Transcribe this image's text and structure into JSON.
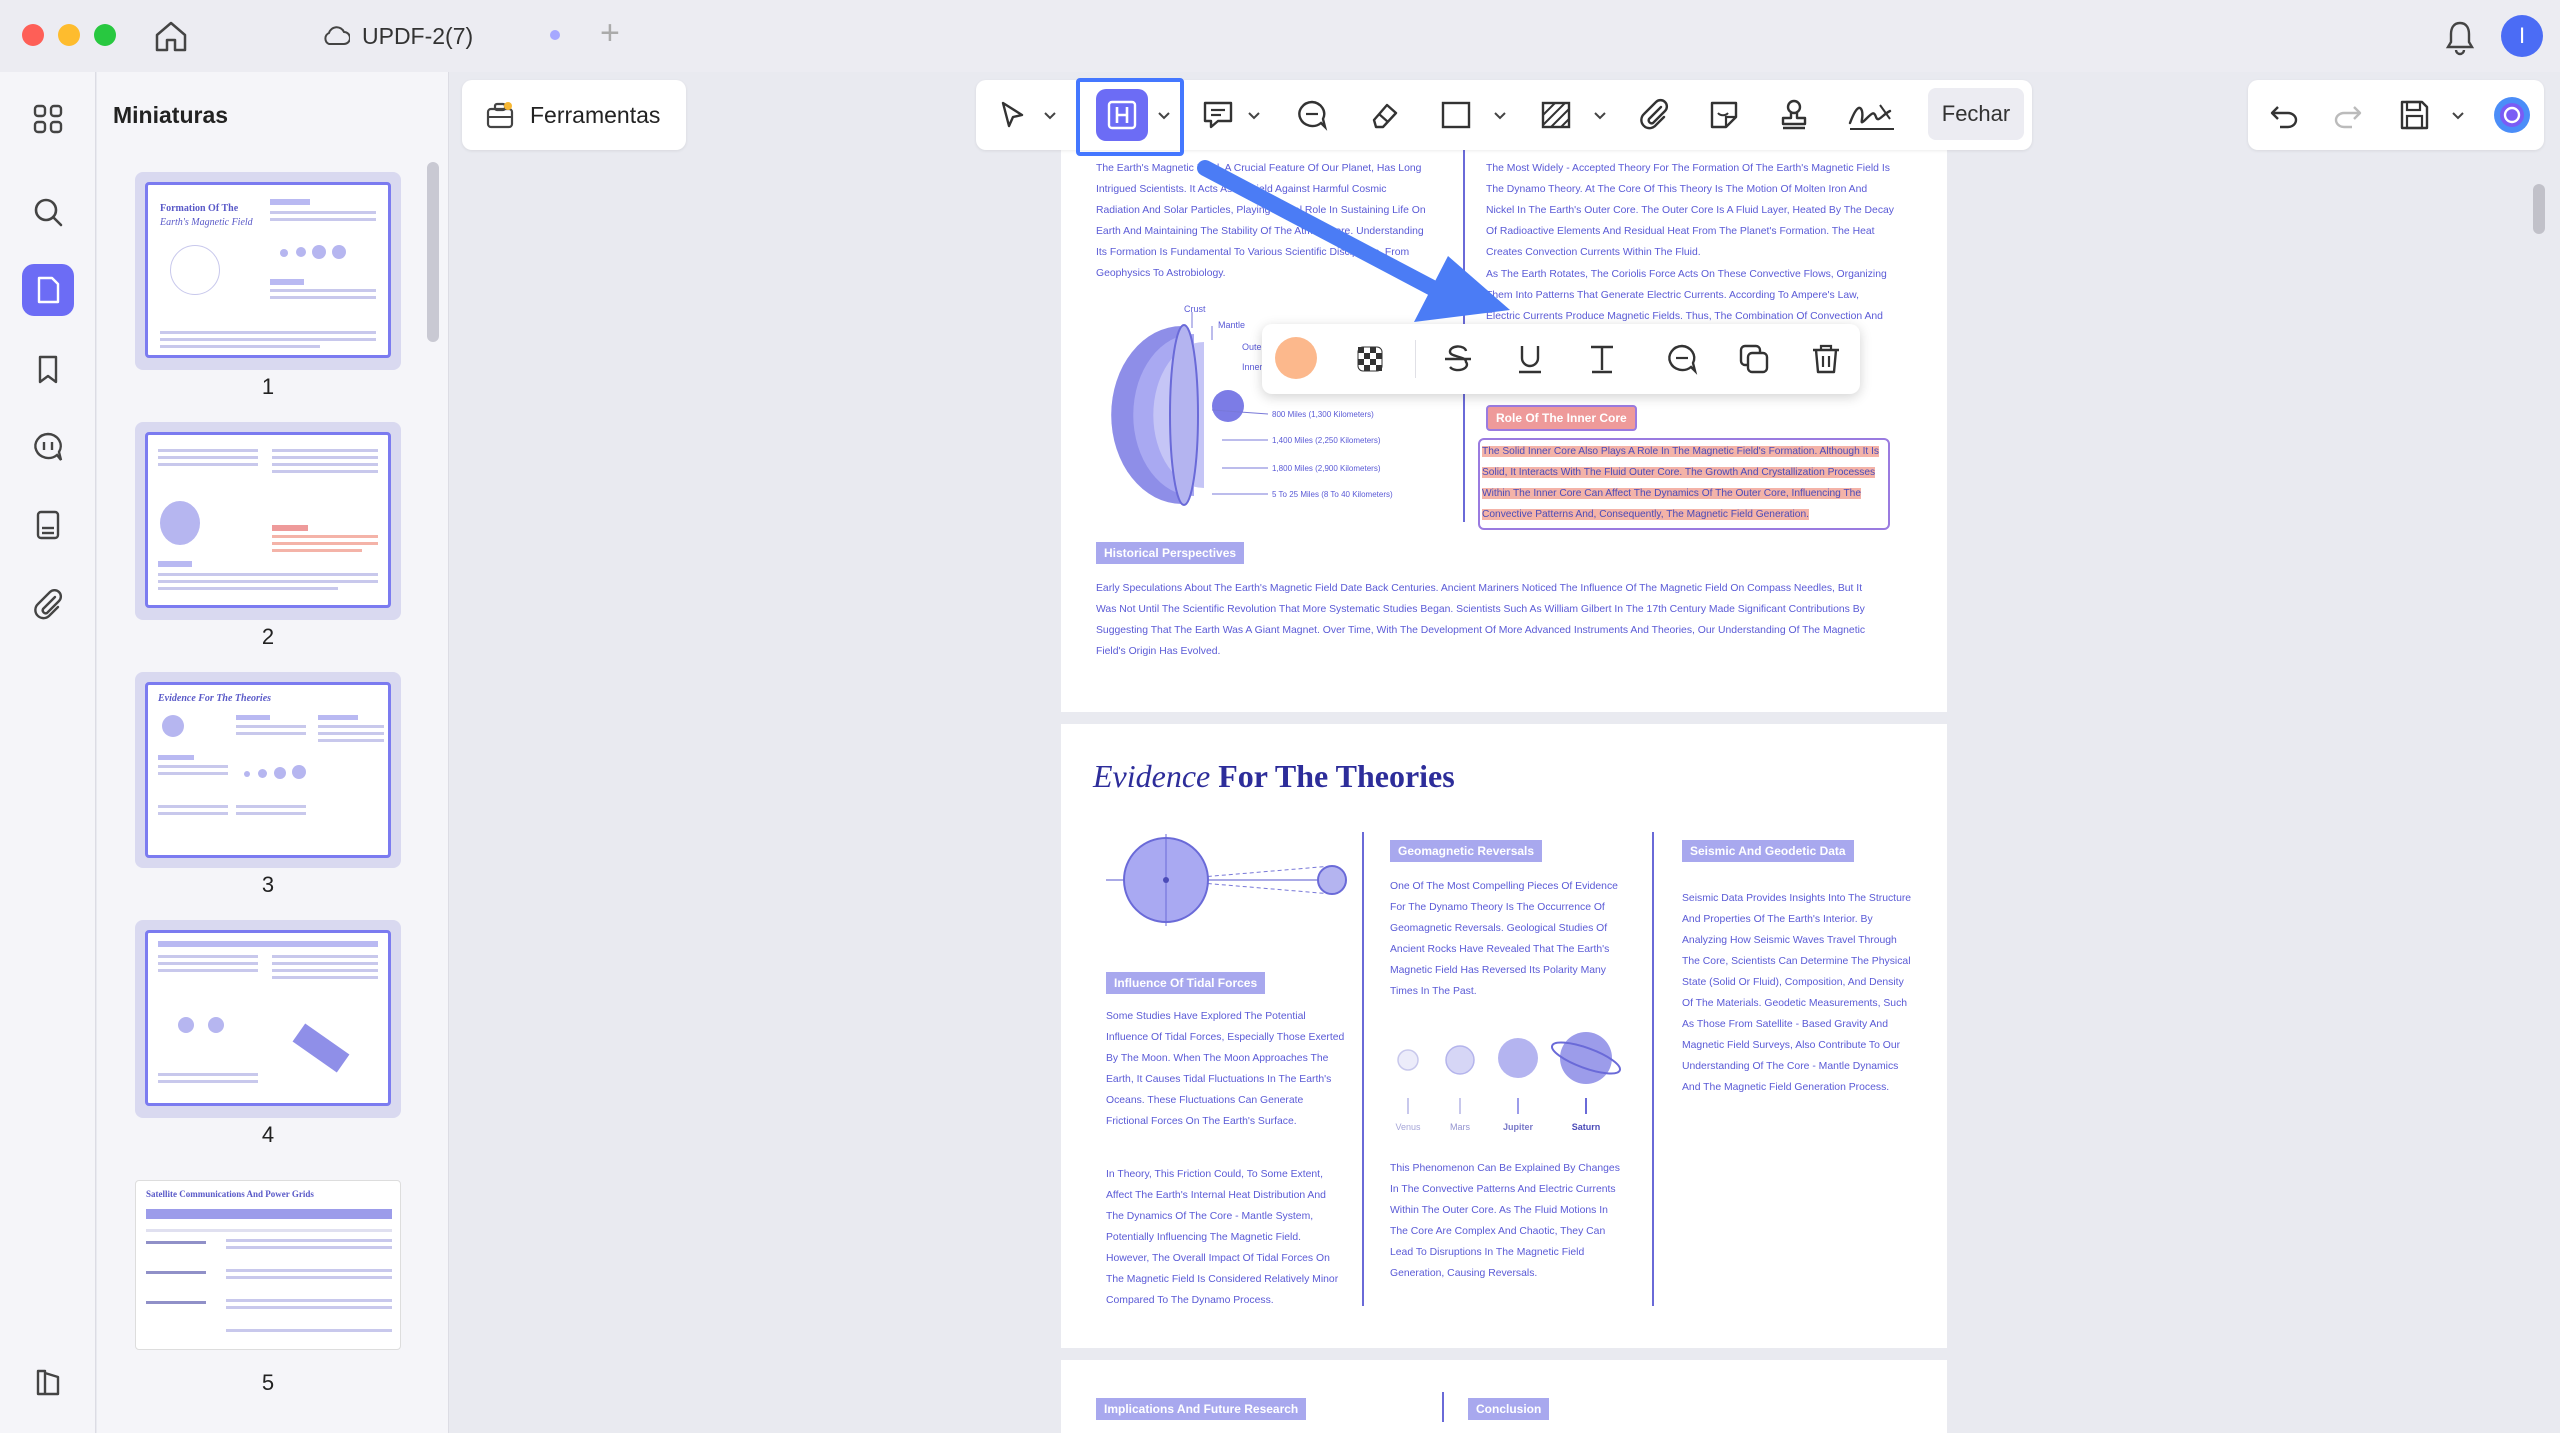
{
  "window": {
    "doc_title": "UPDF-2(7)",
    "avatar_initial": "I"
  },
  "sidebar": {
    "panel_title": "Miniaturas",
    "rail_icons": [
      "grid-icon",
      "search-icon",
      "pages-icon",
      "bookmark-icon",
      "comment-icon",
      "forms-icon",
      "attachment-icon",
      "layers-icon"
    ],
    "thumbnails": [
      {
        "number": "1",
        "title": "Formation Of The",
        "subtitle": "Earth's Magnetic Field"
      },
      {
        "number": "2"
      },
      {
        "number": "3",
        "title": "Evidence For The Theories"
      },
      {
        "number": "4"
      },
      {
        "number": "5",
        "title": "Satellite Communications And Power Grids"
      }
    ]
  },
  "toolbar": {
    "tools_label": "Ferramentas",
    "close_label": "Fechar",
    "tools": [
      "select-icon",
      "highlight-icon",
      "text-comment-icon",
      "note-icon",
      "eraser-icon",
      "rectangle-icon",
      "area-fill-icon",
      "attachment-icon",
      "sticker-icon",
      "stamp-icon",
      "signature-icon"
    ]
  },
  "float_toolbar": {
    "color": "#fcb88c",
    "tools": [
      "opacity-icon",
      "strikethrough-icon",
      "underline-icon",
      "text-icon",
      "comment-icon",
      "copy-icon",
      "delete-icon"
    ]
  },
  "page1": {
    "intro_left": "The Earth's Magnetic Field, A Crucial Feature Of Our Planet, Has Long Intrigued Scientists. It Acts As A Shield Against Harmful Cosmic Radiation And Solar Particles, Playing A Vital Role In Sustaining Life On Earth And Maintaining The Stability Of The Atmosphere. Understanding Its Formation Is Fundamental To Various Scientific Disciplines, From Geophysics To Astrobiology.",
    "intro_right": "The Most Widely - Accepted Theory For The Formation Of The Earth's Magnetic Field Is The Dynamo Theory. At The Core Of This Theory Is The Motion Of Molten Iron And Nickel In The Earth's Outer Core. The Outer Core Is A Fluid Layer, Heated By The Decay Of Radioactive Elements And Residual Heat From The Planet's Formation. The Heat Creates Convection Currents Within The Fluid.",
    "intro_right_2": "As The Earth Rotates, The Coriolis Force Acts On These Convective Flows, Organizing Them Into Patterns That Generate Electric Currents. According To Ampere's Law, Electric Currents Produce Magnetic Fields. Thus, The Combination Of Convection And Rotation In",
    "layers": [
      "Crust",
      "Mantle",
      "Outer core",
      "Inner core"
    ],
    "depths": [
      "800 Miles (1,300 Kilometers)",
      "1,400 Miles (2,250 Kilometers)",
      "1,800 Miles (2,900 Kilometers)",
      "5 To 25 Miles (8 To 40 Kilometers)"
    ],
    "inner_core_badge": "Role Of The Inner Core",
    "inner_core_text": "The Solid Inner Core Also Plays A Role In The Magnetic Field's Formation. Although It Is Solid, It Interacts With The Fluid Outer Core. The Growth And Crystallization Processes Within The Inner Core Can Affect The Dynamics Of The Outer Core, Influencing The Convective Patterns And, Consequently, The Magnetic Field Generation.",
    "historical_badge": "Historical Perspectives",
    "historical_text": "Early Speculations About The Earth's Magnetic Field Date Back Centuries. Ancient Mariners Noticed The Influence Of The Magnetic Field On Compass Needles, But It Was Not Until The Scientific Revolution That More Systematic Studies Began. Scientists Such As William Gilbert In The 17th Century Made Significant Contributions By Suggesting That The Earth Was A Giant Magnet. Over Time, With The Development Of More Advanced Instruments And Theories, Our Understanding Of The Magnetic Field's Origin Has Evolved."
  },
  "page2": {
    "title_italic": "Evidence",
    "title_rest": "For The Theories",
    "geomagnetic_badge": "Geomagnetic Reversals",
    "geomagnetic_text": "One Of The Most Compelling Pieces Of Evidence For The Dynamo Theory Is The Occurrence Of Geomagnetic Reversals. Geological Studies Of Ancient Rocks Have Revealed That The Earth's Magnetic Field Has Reversed Its Polarity Many Times In The Past.",
    "seismic_badge": "Seismic And Geodetic Data",
    "seismic_text": "Seismic Data Provides Insights Into The Structure And Properties Of The Earth's Interior. By Analyzing How Seismic Waves Travel Through The Core, Scientists Can Determine The Physical State (Solid Or Fluid), Composition, And Density Of The Materials. Geodetic Measurements, Such As Those From Satellite - Based Gravity And Magnetic Field Surveys, Also Contribute To Our Understanding Of The Core - Mantle Dynamics And The Magnetic Field Generation Process.",
    "tidal_badge": "Influence Of Tidal Forces",
    "tidal_text": "Some Studies Have Explored The Potential Influence Of Tidal Forces, Especially Those Exerted By The Moon. When The Moon Approaches The Earth, It Causes Tidal Fluctuations In The Earth's Oceans. These Fluctuations Can Generate Frictional Forces On The Earth's Surface.",
    "tidal_text_2": "In Theory, This Friction Could, To Some Extent, Affect The Earth's Internal Heat Distribution And The Dynamics Of The Core - Mantle System, Potentially Influencing The Magnetic Field. However, The Overall Impact Of Tidal Forces On The Magnetic Field Is Considered Relatively Minor Compared To The Dynamo Process.",
    "planets": [
      "Venus",
      "Mars",
      "Jupiter",
      "Saturn"
    ],
    "phenomenon_text": "This Phenomenon Can Be Explained By Changes In The Convective Patterns And Electric Currents Within The Outer Core. As The Fluid Motions In The Core Are Complex And Chaotic, They Can Lead To Disruptions In The Magnetic Field Generation, Causing Reversals."
  },
  "page3": {
    "badge_left": "Implications And Future Research",
    "badge_right": "Conclusion"
  }
}
